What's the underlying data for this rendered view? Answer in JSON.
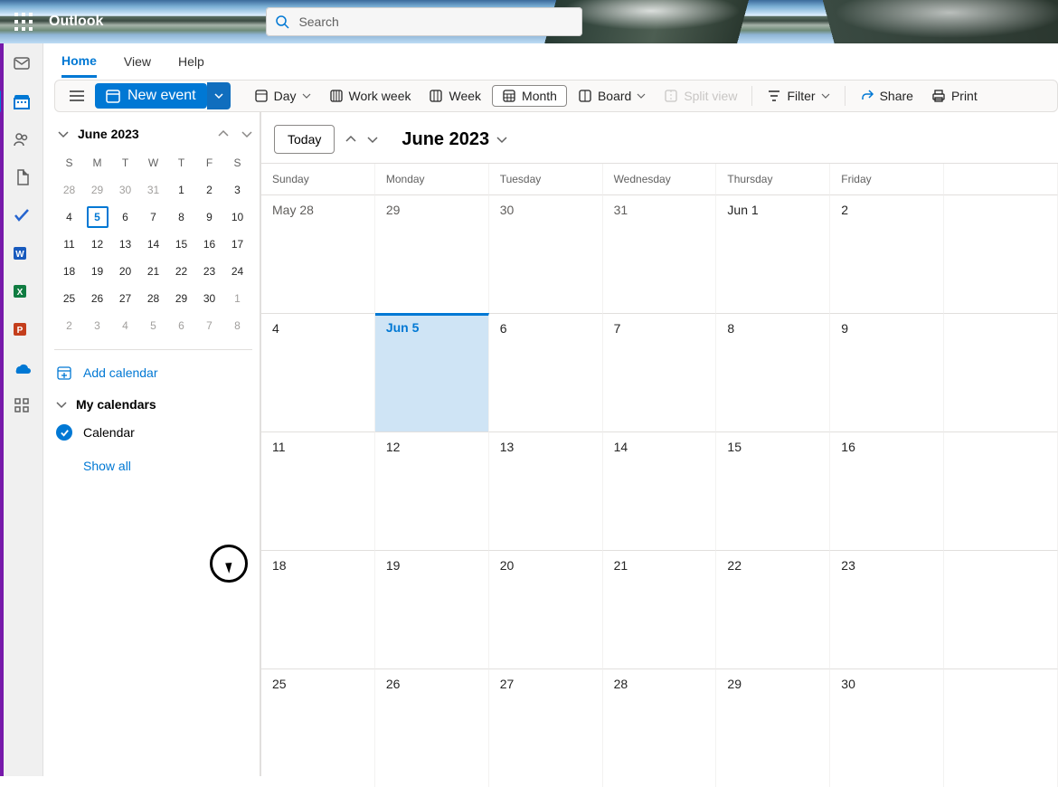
{
  "app": {
    "name": "Outlook"
  },
  "search": {
    "placeholder": "Search"
  },
  "nav": {
    "home": "Home",
    "view": "View",
    "help": "Help"
  },
  "ribbon": {
    "new_event": "New event",
    "day": "Day",
    "work_week": "Work week",
    "week": "Week",
    "month": "Month",
    "board": "Board",
    "split_view": "Split view",
    "filter": "Filter",
    "share": "Share",
    "print": "Print"
  },
  "miniCal": {
    "month_label": "June 2023",
    "dow": [
      "S",
      "M",
      "T",
      "W",
      "T",
      "F",
      "S"
    ],
    "rows": [
      [
        {
          "d": "28",
          "o": true
        },
        {
          "d": "29",
          "o": true
        },
        {
          "d": "30",
          "o": true
        },
        {
          "d": "31",
          "o": true
        },
        {
          "d": "1"
        },
        {
          "d": "2"
        },
        {
          "d": "3"
        }
      ],
      [
        {
          "d": "4"
        },
        {
          "d": "5",
          "today": true
        },
        {
          "d": "6"
        },
        {
          "d": "7"
        },
        {
          "d": "8"
        },
        {
          "d": "9"
        },
        {
          "d": "10"
        }
      ],
      [
        {
          "d": "11"
        },
        {
          "d": "12"
        },
        {
          "d": "13"
        },
        {
          "d": "14"
        },
        {
          "d": "15"
        },
        {
          "d": "16"
        },
        {
          "d": "17"
        }
      ],
      [
        {
          "d": "18"
        },
        {
          "d": "19"
        },
        {
          "d": "20"
        },
        {
          "d": "21"
        },
        {
          "d": "22"
        },
        {
          "d": "23"
        },
        {
          "d": "24"
        }
      ],
      [
        {
          "d": "25"
        },
        {
          "d": "26"
        },
        {
          "d": "27"
        },
        {
          "d": "28"
        },
        {
          "d": "29"
        },
        {
          "d": "30"
        },
        {
          "d": "1",
          "o": true
        }
      ],
      [
        {
          "d": "2",
          "o": true
        },
        {
          "d": "3",
          "o": true
        },
        {
          "d": "4",
          "o": true
        },
        {
          "d": "5",
          "o": true
        },
        {
          "d": "6",
          "o": true
        },
        {
          "d": "7",
          "o": true
        },
        {
          "d": "8",
          "o": true
        }
      ]
    ]
  },
  "side": {
    "add_calendar": "Add calendar",
    "my_calendars": "My calendars",
    "calendar": "Calendar",
    "show_all": "Show all"
  },
  "mainCal": {
    "today_btn": "Today",
    "period": "June 2023",
    "dow": [
      "Sunday",
      "Monday",
      "Tuesday",
      "Wednesday",
      "Thursday",
      "Friday"
    ],
    "cells": [
      [
        {
          "t": "May 28",
          "o": true
        },
        {
          "t": "29",
          "o": true
        },
        {
          "t": "30",
          "o": true
        },
        {
          "t": "31",
          "o": true
        },
        {
          "t": "Jun 1"
        },
        {
          "t": "2"
        },
        {
          "t": ""
        }
      ],
      [
        {
          "t": "4"
        },
        {
          "t": "Jun 5",
          "today": true
        },
        {
          "t": "6"
        },
        {
          "t": "7"
        },
        {
          "t": "8"
        },
        {
          "t": "9"
        },
        {
          "t": ""
        }
      ],
      [
        {
          "t": "11"
        },
        {
          "t": "12"
        },
        {
          "t": "13"
        },
        {
          "t": "14"
        },
        {
          "t": "15"
        },
        {
          "t": "16"
        },
        {
          "t": ""
        }
      ],
      [
        {
          "t": "18"
        },
        {
          "t": "19"
        },
        {
          "t": "20"
        },
        {
          "t": "21"
        },
        {
          "t": "22"
        },
        {
          "t": "23"
        },
        {
          "t": ""
        }
      ],
      [
        {
          "t": "25"
        },
        {
          "t": "26"
        },
        {
          "t": "27"
        },
        {
          "t": "28"
        },
        {
          "t": "29"
        },
        {
          "t": "30"
        },
        {
          "t": ""
        }
      ]
    ]
  }
}
